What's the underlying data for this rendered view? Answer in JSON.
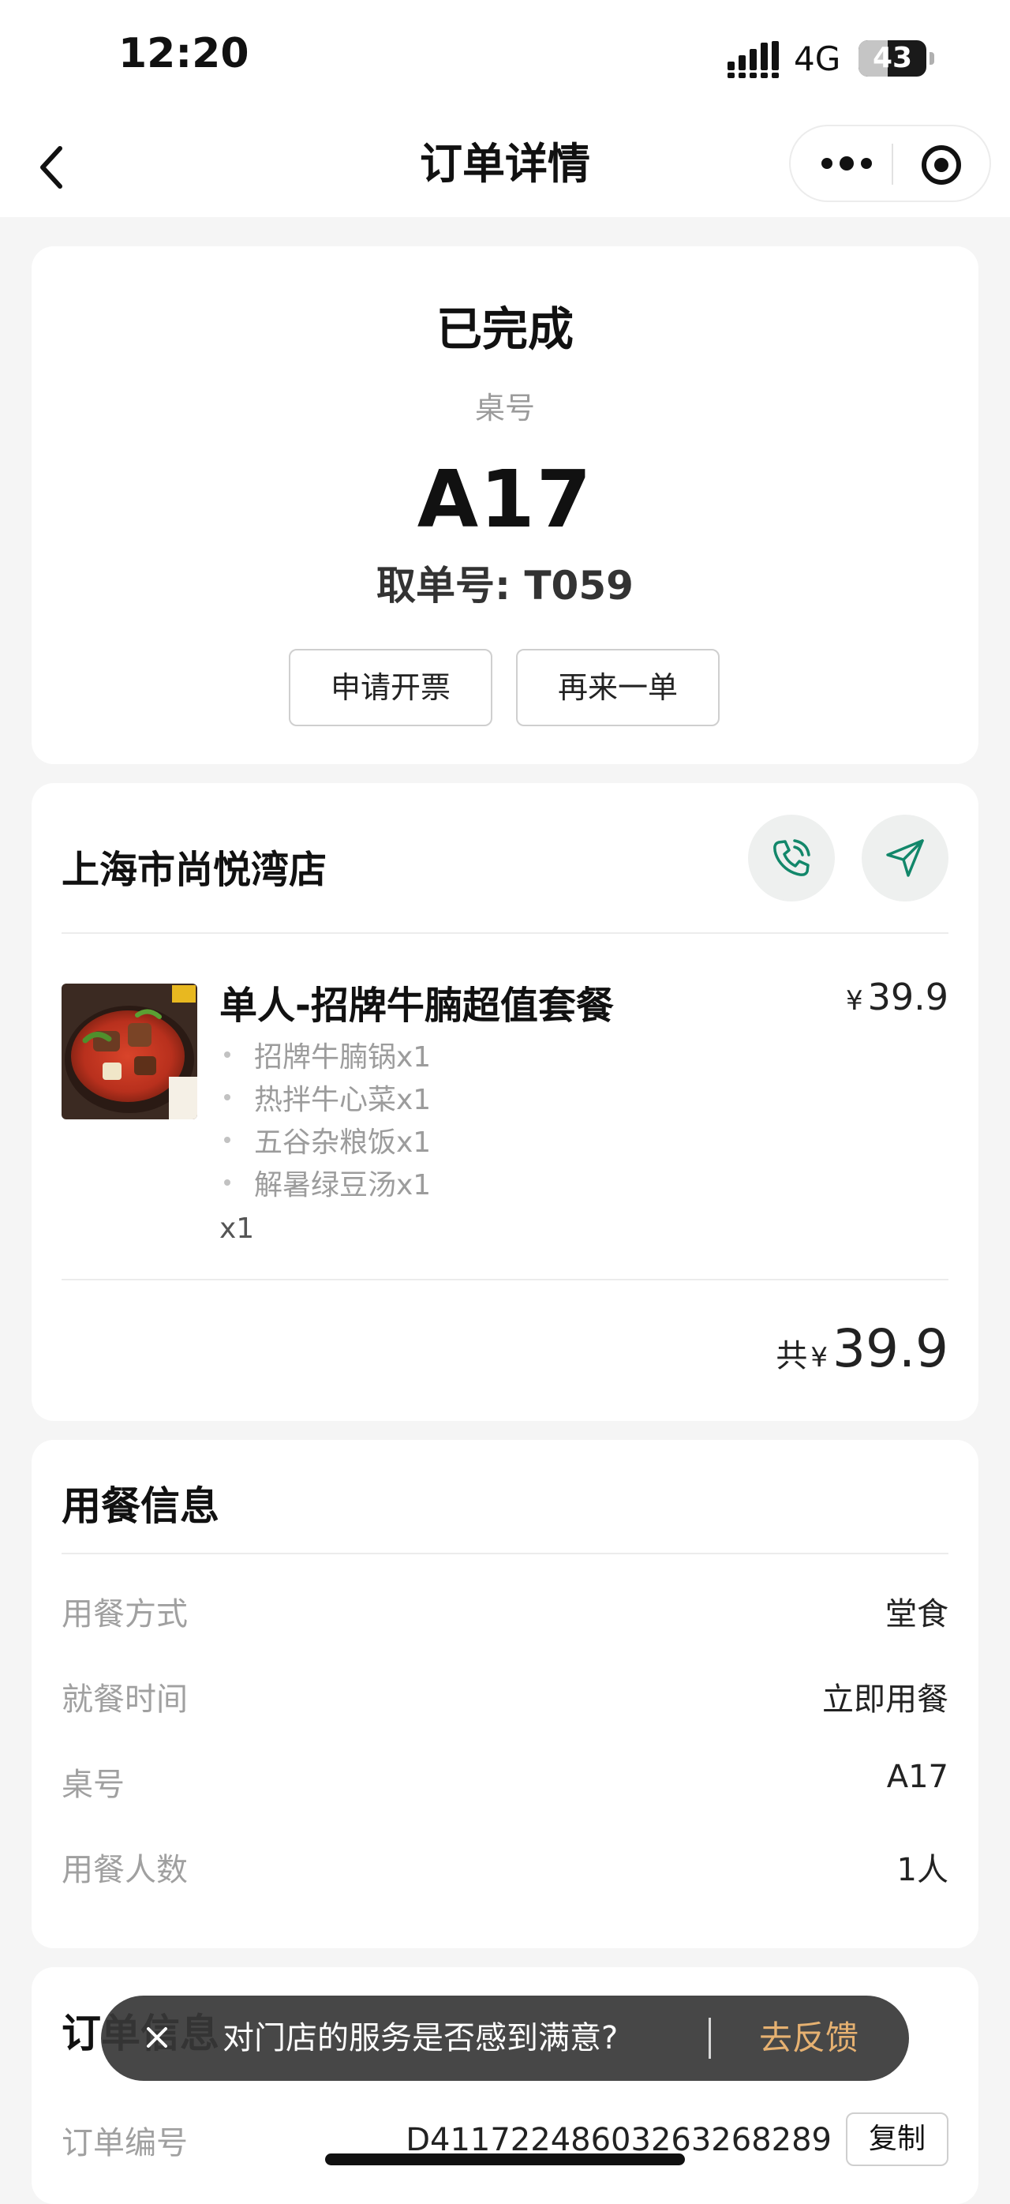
{
  "status_bar": {
    "time": "12:20",
    "network": "4G",
    "battery": "43",
    "battery_level": 0.43
  },
  "nav": {
    "title": "订单详情",
    "back_icon": "chevron-left-icon",
    "more_icon": "more-dots-icon",
    "target_icon": "target-icon"
  },
  "order": {
    "status": "已完成",
    "table_label": "桌号",
    "table_number": "A17",
    "pickup": "取单号: T059",
    "invoice_button": "申请开票",
    "reorder_button": "再来一单"
  },
  "store": {
    "name": "上海市尚悦湾店",
    "phone_icon": "phone-icon",
    "navigate_icon": "navigate-icon",
    "item": {
      "name": "单人-招牌牛腩超值套餐",
      "currency": "¥",
      "price": "39.9",
      "subitems": [
        "招牌牛腩锅x1",
        "热拌牛心菜x1",
        "五谷杂粮饭x1",
        "解暑绿豆汤x1"
      ],
      "quantity": "x1"
    },
    "total_prefix": "共",
    "currency": "¥",
    "total": "39.9"
  },
  "dining": {
    "title": "用餐信息",
    "rows": [
      {
        "label": "用餐方式",
        "value": "堂食"
      },
      {
        "label": "就餐时间",
        "value": "立即用餐"
      },
      {
        "label": "桌号",
        "value": "A17"
      },
      {
        "label": "用餐人数",
        "value": "1人"
      }
    ]
  },
  "order_info": {
    "title": "订单信息",
    "rows": [
      {
        "label": "订单编号",
        "value": "D41172248603263268289"
      }
    ],
    "copy_button": "复制"
  },
  "toast": {
    "message": "对门店的服务是否感到满意?",
    "action": "去反馈",
    "close_icon": "close-icon"
  },
  "colors": {
    "accent_green": "#12876a",
    "feedback_orange": "#e6b171"
  }
}
